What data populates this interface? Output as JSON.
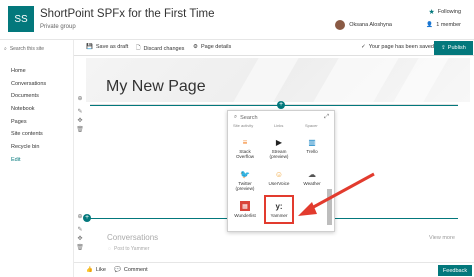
{
  "header": {
    "logo_text": "SS",
    "title": "ShortPoint SPFx for the First Time",
    "subtitle": "Private group",
    "following": "Following",
    "user_name": "Oksana Aloshyna",
    "members": "1 member"
  },
  "nav": {
    "search_placeholder": "Search this site",
    "items": [
      "Home",
      "Conversations",
      "Documents",
      "Notebook",
      "Pages",
      "Site contents",
      "Recycle bin",
      "Edit"
    ]
  },
  "commandbar": {
    "save_draft": "Save as draft",
    "discard": "Discard changes",
    "page_details": "Page details",
    "saved_message": "Your page has been saved",
    "publish": "Publish"
  },
  "page": {
    "title": "My New Page"
  },
  "picker": {
    "search": "Search",
    "cut_labels": [
      "Site activity",
      "Links",
      "Spacer"
    ],
    "tiles": [
      {
        "label": "Stack Overflow",
        "icon": "stack-overflow-icon"
      },
      {
        "label": "Stream (preview)",
        "icon": "stream-icon"
      },
      {
        "label": "Trello",
        "icon": "trello-icon"
      },
      {
        "label": "Twitter (preview)",
        "icon": "twitter-icon"
      },
      {
        "label": "UserVoice",
        "icon": "uservoice-icon"
      },
      {
        "label": "Weather",
        "icon": "weather-icon"
      },
      {
        "label": "Wunderlist",
        "icon": "wunderlist-icon"
      },
      {
        "label": "Yammer",
        "icon": "yammer-icon"
      }
    ]
  },
  "conversations": {
    "title": "Conversations",
    "post": "Post to Yammer",
    "view_more": "View more"
  },
  "footer": {
    "like": "Like",
    "comment": "Comment",
    "feedback": "Feedback"
  },
  "colors": {
    "accent": "#03787c",
    "highlight": "#e23b2e"
  }
}
